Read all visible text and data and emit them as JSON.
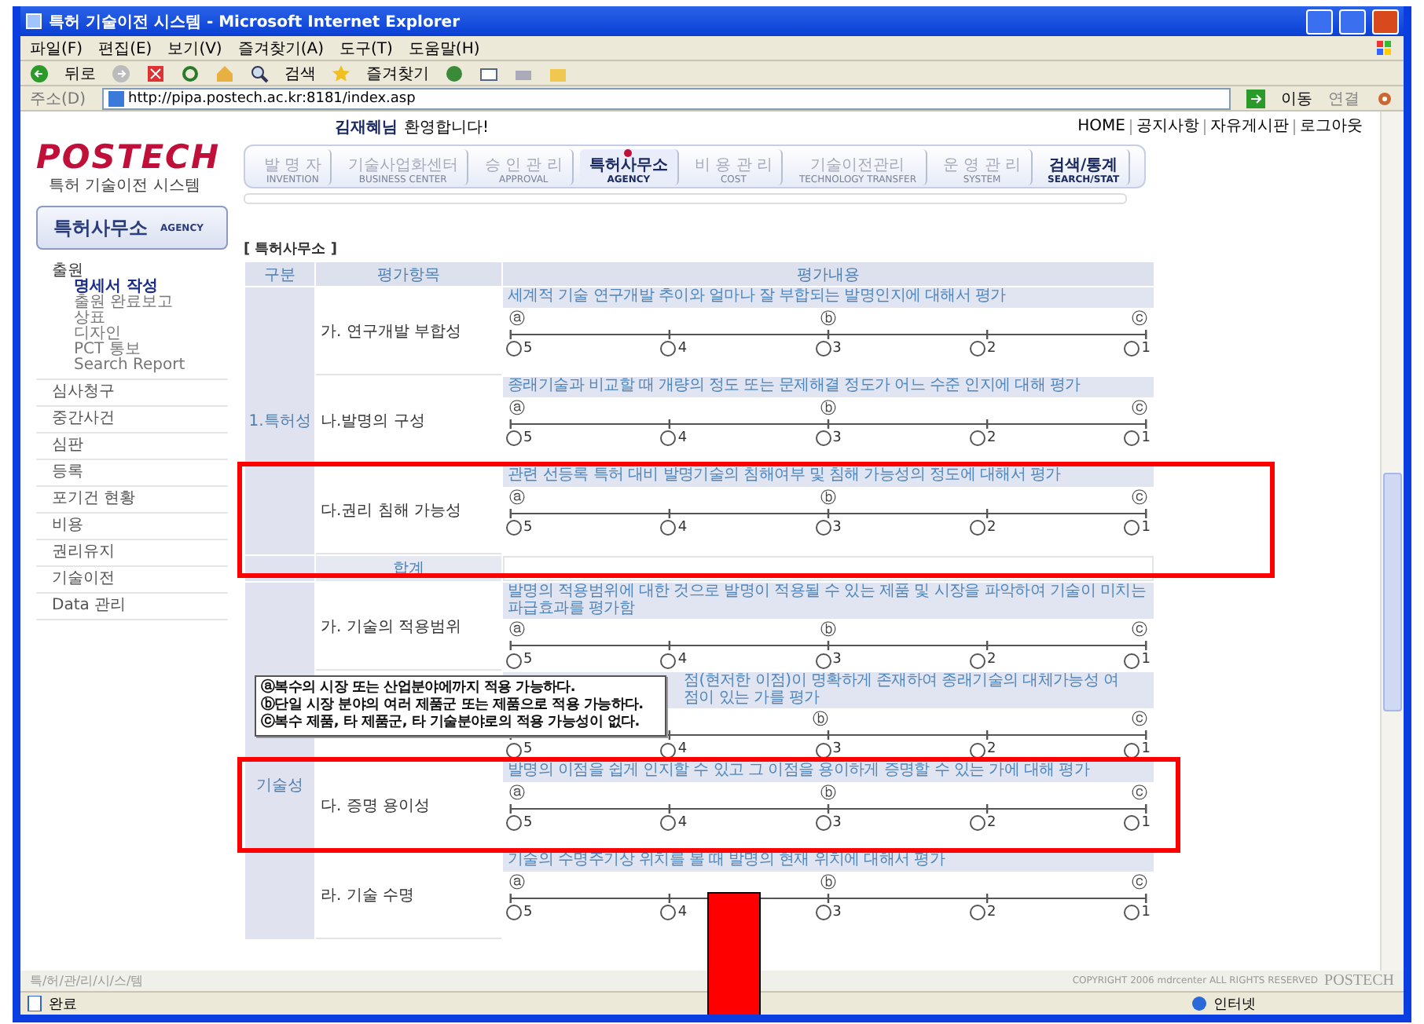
{
  "window": {
    "title": "특허 기술이전 시스템 - Microsoft Internet Explorer"
  },
  "menu": [
    "파일(F)",
    "편집(E)",
    "보기(V)",
    "즐겨찾기(A)",
    "도구(T)",
    "도움말(H)"
  ],
  "toolbar": {
    "back": "뒤로",
    "search": "검색",
    "favorites": "즐겨찾기"
  },
  "address_bar": {
    "label": "주소(D)",
    "url": "http://pipa.postech.ac.kr:8181/index.asp",
    "go": "이동",
    "links": "연결"
  },
  "header": {
    "user": "김재혜님",
    "welcome": "환영합니다!",
    "links": [
      "HOME",
      "공지사항",
      "자유게시판",
      "로그아웃"
    ],
    "logo": "POSTECH",
    "logo_sub": "특허 기술이전 시스템"
  },
  "nav": [
    {
      "label": "발 명 자",
      "sub": "INVENTION",
      "selected": false,
      "enabled": false
    },
    {
      "label": "기술사업화센터",
      "sub": "BUSINESS CENTER",
      "selected": false,
      "enabled": false
    },
    {
      "label": "승 인 관 리",
      "sub": "APPROVAL",
      "selected": false,
      "enabled": false
    },
    {
      "label": "특허사무소",
      "sub": "AGENCY",
      "selected": true,
      "enabled": true
    },
    {
      "label": "비 용 관 리",
      "sub": "COST",
      "selected": false,
      "enabled": false
    },
    {
      "label": "기술이전관리",
      "sub": "TECHNOLOGY TRANSFER",
      "selected": false,
      "enabled": false
    },
    {
      "label": "운 영 관 리",
      "sub": "SYSTEM",
      "selected": false,
      "enabled": false
    },
    {
      "label": "검색/통계",
      "sub": "SEARCH/STAT",
      "selected": false,
      "enabled": true
    }
  ],
  "sidebar": {
    "title": "특허사무소",
    "title_sub": "AGENCY",
    "items": [
      {
        "label": "출원",
        "expanded": true,
        "children": [
          {
            "label": "명세서 작성",
            "selected": true
          },
          {
            "label": "출원 완료보고",
            "selected": false
          },
          {
            "label": "상표",
            "selected": false
          },
          {
            "label": "디자인",
            "selected": false
          },
          {
            "label": "PCT 통보",
            "selected": false
          },
          {
            "label": "Search Report",
            "selected": false
          }
        ]
      },
      {
        "label": "심사청구",
        "expanded": false
      },
      {
        "label": "중간사건",
        "expanded": false
      },
      {
        "label": "심판",
        "expanded": false
      },
      {
        "label": "등록",
        "expanded": false
      },
      {
        "label": "포기건 현황",
        "expanded": false
      },
      {
        "label": "비용",
        "expanded": false
      },
      {
        "label": "권리유지",
        "expanded": false
      },
      {
        "label": "기술이전",
        "expanded": false
      },
      {
        "label": "Data 관리",
        "expanded": false
      }
    ]
  },
  "evaluation": {
    "title": "[ 특허사무소 ]",
    "columns": [
      "구분",
      "평가항목",
      "평가내용"
    ],
    "groups": [
      {
        "label": "1.특허성",
        "total_label": "합계",
        "items": [
          {
            "label": "가. 연구개발 부합성",
            "description": [
              "세계적 기술 연구개발 추이와 얼마나 잘 부합되는 발명인지에 대해서 평가"
            ],
            "markers": [
              "ⓐ",
              "ⓑ",
              "ⓒ"
            ],
            "options": [
              {
                "label": "5",
                "selected": false
              },
              {
                "label": "4",
                "selected": false
              },
              {
                "label": "3",
                "selected": false
              },
              {
                "label": "2",
                "selected": false
              },
              {
                "label": "1",
                "selected": false
              }
            ]
          },
          {
            "label": "나.발명의 구성",
            "description": [
              "종래기술과 비교할 때 개량의 정도 또는 문제해결 정도가 어느 수준 인지에 대해 평가"
            ],
            "markers": [
              "ⓐ",
              "ⓑ",
              "ⓒ"
            ],
            "options": [
              {
                "label": "5",
                "selected": false
              },
              {
                "label": "4",
                "selected": false
              },
              {
                "label": "3",
                "selected": false
              },
              {
                "label": "2",
                "selected": false
              },
              {
                "label": "1",
                "selected": false
              }
            ]
          },
          {
            "label": "다.권리 침해 가능성",
            "description": [
              "관련 선등록 특허 대비 발명기술의 침해여부 및 침해 가능성의 정도에 대해서 평가"
            ],
            "markers": [
              "ⓐ",
              "ⓑ",
              "ⓒ"
            ],
            "options": [
              {
                "label": "5",
                "selected": false
              },
              {
                "label": "4",
                "selected": false
              },
              {
                "label": "3",
                "selected": false
              },
              {
                "label": "2",
                "selected": false
              },
              {
                "label": "1",
                "selected": false
              }
            ]
          }
        ]
      },
      {
        "label": "기술성",
        "items": [
          {
            "label": "가. 기술의 적용범위",
            "description": [
              "발명의 적용범위에 대한 것으로 발명이 적용될 수 있는 제품 및 시장을 파악하여 기술이 미치는 파급효과를 평가함"
            ],
            "markers": [
              "ⓐ",
              "ⓑ",
              "ⓒ"
            ],
            "options": [
              {
                "label": "5",
                "selected": false
              },
              {
                "label": "4",
                "selected": false
              },
              {
                "label": "3",
                "selected": false
              },
              {
                "label": "2",
                "selected": false
              },
              {
                "label": "1",
                "selected": false
              }
            ]
          },
          {
            "covered": true,
            "description": [
              "점(현저한 이점)이 명확하게 존재하여 종래기술의 대체가능성 여",
              "점이 있는 가를 평가"
            ],
            "markers": [
              "ⓑ",
              "ⓒ"
            ],
            "options": [
              {
                "label": "5",
                "selected": false
              },
              {
                "label": "4",
                "selected": false
              },
              {
                "label": "3",
                "selected": false
              },
              {
                "label": "2",
                "selected": false
              },
              {
                "label": "1",
                "selected": false
              }
            ]
          },
          {
            "label": "다. 증명 용이성",
            "description": [
              "발명의 이점을 쉽게 인지할 수 있고 그 이점을 용이하게 증명할 수 있는 가에 대해 평가"
            ],
            "markers": [
              "ⓐ",
              "ⓑ",
              "ⓒ"
            ],
            "options": [
              {
                "label": "5",
                "selected": false
              },
              {
                "label": "4",
                "selected": false
              },
              {
                "label": "3",
                "selected": false
              },
              {
                "label": "2",
                "selected": false
              },
              {
                "label": "1",
                "selected": false
              }
            ]
          },
          {
            "label": "라. 기술 수명",
            "description": [
              "기술의 수명주기상 위치를 볼 때 발명의 현재 위치에 대해서 평가"
            ],
            "markers": [
              "ⓐ",
              "ⓑ",
              "ⓒ"
            ],
            "options": [
              {
                "label": "5",
                "selected": false
              },
              {
                "label": "4",
                "selected": false
              },
              {
                "label": "3",
                "selected": false
              },
              {
                "label": "2",
                "selected": false
              },
              {
                "label": "1",
                "selected": false
              }
            ]
          }
        ]
      }
    ]
  },
  "tooltip": {
    "lines": [
      "ⓐ복수의 시장 또는 산업분야에까지 적용 가능하다.",
      "ⓑ단일 시장 분야의 여러 제품군 또는 제품으로 적용 가능하다.",
      "ⓒ복수 제품, 타 제품군, 타 기술분야로의 적용 가능성이 없다."
    ]
  },
  "footer": {
    "left": "특/허/관/리/시/스/템",
    "copyright": "COPYRIGHT 2006 mdrcenter ALL RIGHTS RESERVED",
    "brand": "POSTECH"
  },
  "status_bar": {
    "text": "완료",
    "zone": "인터넷"
  }
}
